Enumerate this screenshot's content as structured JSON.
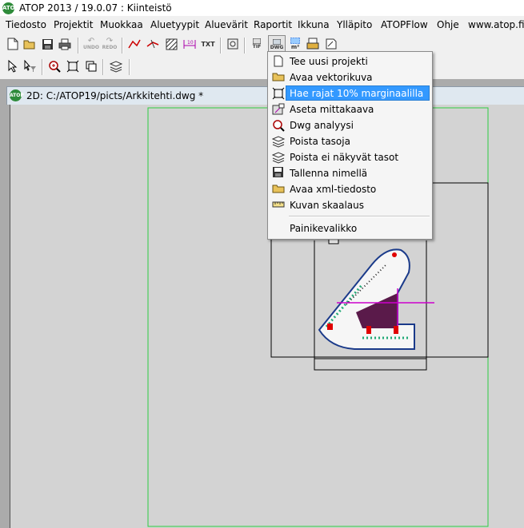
{
  "window": {
    "title": "ATOP 2013 / 19.0.07 : Kiinteistö",
    "icon_text": "ATOP"
  },
  "menubar": {
    "items": [
      "Tiedosto",
      "Projektit",
      "Muokkaa",
      "Aluetyypit",
      "Aluevärit",
      "Raportit",
      "Ikkuna",
      "Ylläpito",
      "ATOPFlow",
      "Ohje",
      "www.atop.fi"
    ]
  },
  "toolbar": {
    "undo_label": "UNDO",
    "redo_label": "REDO",
    "txt_label": "TXT",
    "tif_label": "TIF",
    "dwg_label": "DWG",
    "m2_label": "m²"
  },
  "document": {
    "title": "2D: C:/ATOP19/picts/Arkkitehti.dwg *"
  },
  "dropdown": {
    "items": [
      {
        "label": "Tee uusi projekti",
        "icon": "new-file-icon"
      },
      {
        "label": "Avaa vektorikuva",
        "icon": "open-folder-icon"
      },
      {
        "label": "Hae rajat 10% marginaalilla",
        "icon": "fit-bounds-icon",
        "selected": true
      },
      {
        "label": "Aseta mittakaava",
        "icon": "scale-icon"
      },
      {
        "label": "Dwg analyysi",
        "icon": "magnify-icon"
      },
      {
        "label": "Poista tasoja",
        "icon": "layers-icon"
      },
      {
        "label": "Poista ei näkyvät tasot",
        "icon": "layers-icon"
      },
      {
        "label": "Tallenna nimellä",
        "icon": "save-icon"
      },
      {
        "label": "Avaa xml-tiedosto",
        "icon": "open-folder-icon"
      },
      {
        "label": "Kuvan skaalaus",
        "icon": "ruler-icon"
      }
    ],
    "footer_item": "Painikevalikko"
  },
  "colors": {
    "highlight": "#3399ff",
    "frame_green": "#2ecc40",
    "drawing_magenta": "#cc00cc",
    "drawing_red": "#e00000"
  }
}
